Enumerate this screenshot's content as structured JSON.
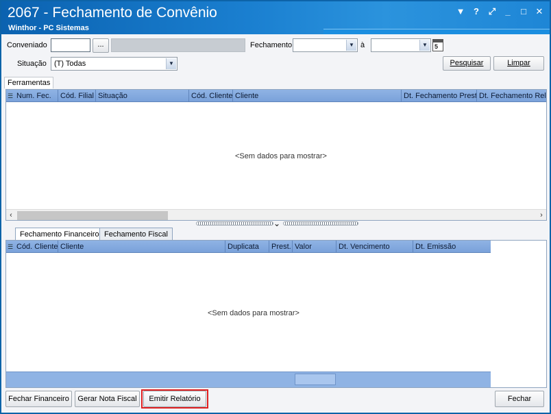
{
  "window": {
    "title": "2067 - Fechamento de Convênio",
    "subtitle": "Winthor - PC Sistemas",
    "controls": [
      "▼",
      "?",
      "⤢",
      "_",
      "□",
      "✕"
    ]
  },
  "filters": {
    "conveniado_label": "Conveniado",
    "conveniado_value": "",
    "lookup_button": "...",
    "conveniado_name": "",
    "fechamento_label": "Fechamento",
    "fechamento_from": "",
    "ate_label": "à",
    "fechamento_to": "",
    "situacao_label": "Situação",
    "situacao_value": "(T) Todas",
    "pesquisar_button": "Pesquisar",
    "limpar_button": "Limpar"
  },
  "toolstrip": {
    "tab_label": "Ferramentas"
  },
  "grid1": {
    "columns": [
      "Num. Fec.",
      "Cód. Filial",
      "Situação",
      "Cód. Cliente",
      "Cliente",
      "Dt. Fechamento Prest",
      "Dt. Fechamento Rel."
    ],
    "empty_message": "<Sem dados para mostrar>"
  },
  "tabs": {
    "items": [
      "Fechamento Financeiro",
      "Fechamento Fiscal"
    ],
    "active": "Fechamento Financeiro"
  },
  "grid2": {
    "columns": [
      "Cód. Cliente",
      "Cliente",
      "Duplicata",
      "Prest.",
      "Valor",
      "Dt. Vencimento",
      "Dt. Emissão"
    ],
    "empty_message": "<Sem dados para mostrar>"
  },
  "actions": {
    "fechar_financeiro": "Fechar Financeiro",
    "gerar_nota_fiscal": "Gerar Nota Fiscal",
    "emitir_relatorio": "Emitir Relatório",
    "fechar": "Fechar"
  },
  "colors": {
    "title_bar": "#1a7fd0",
    "grid_header": "#8fb3e4",
    "highlight": "#e02020"
  }
}
